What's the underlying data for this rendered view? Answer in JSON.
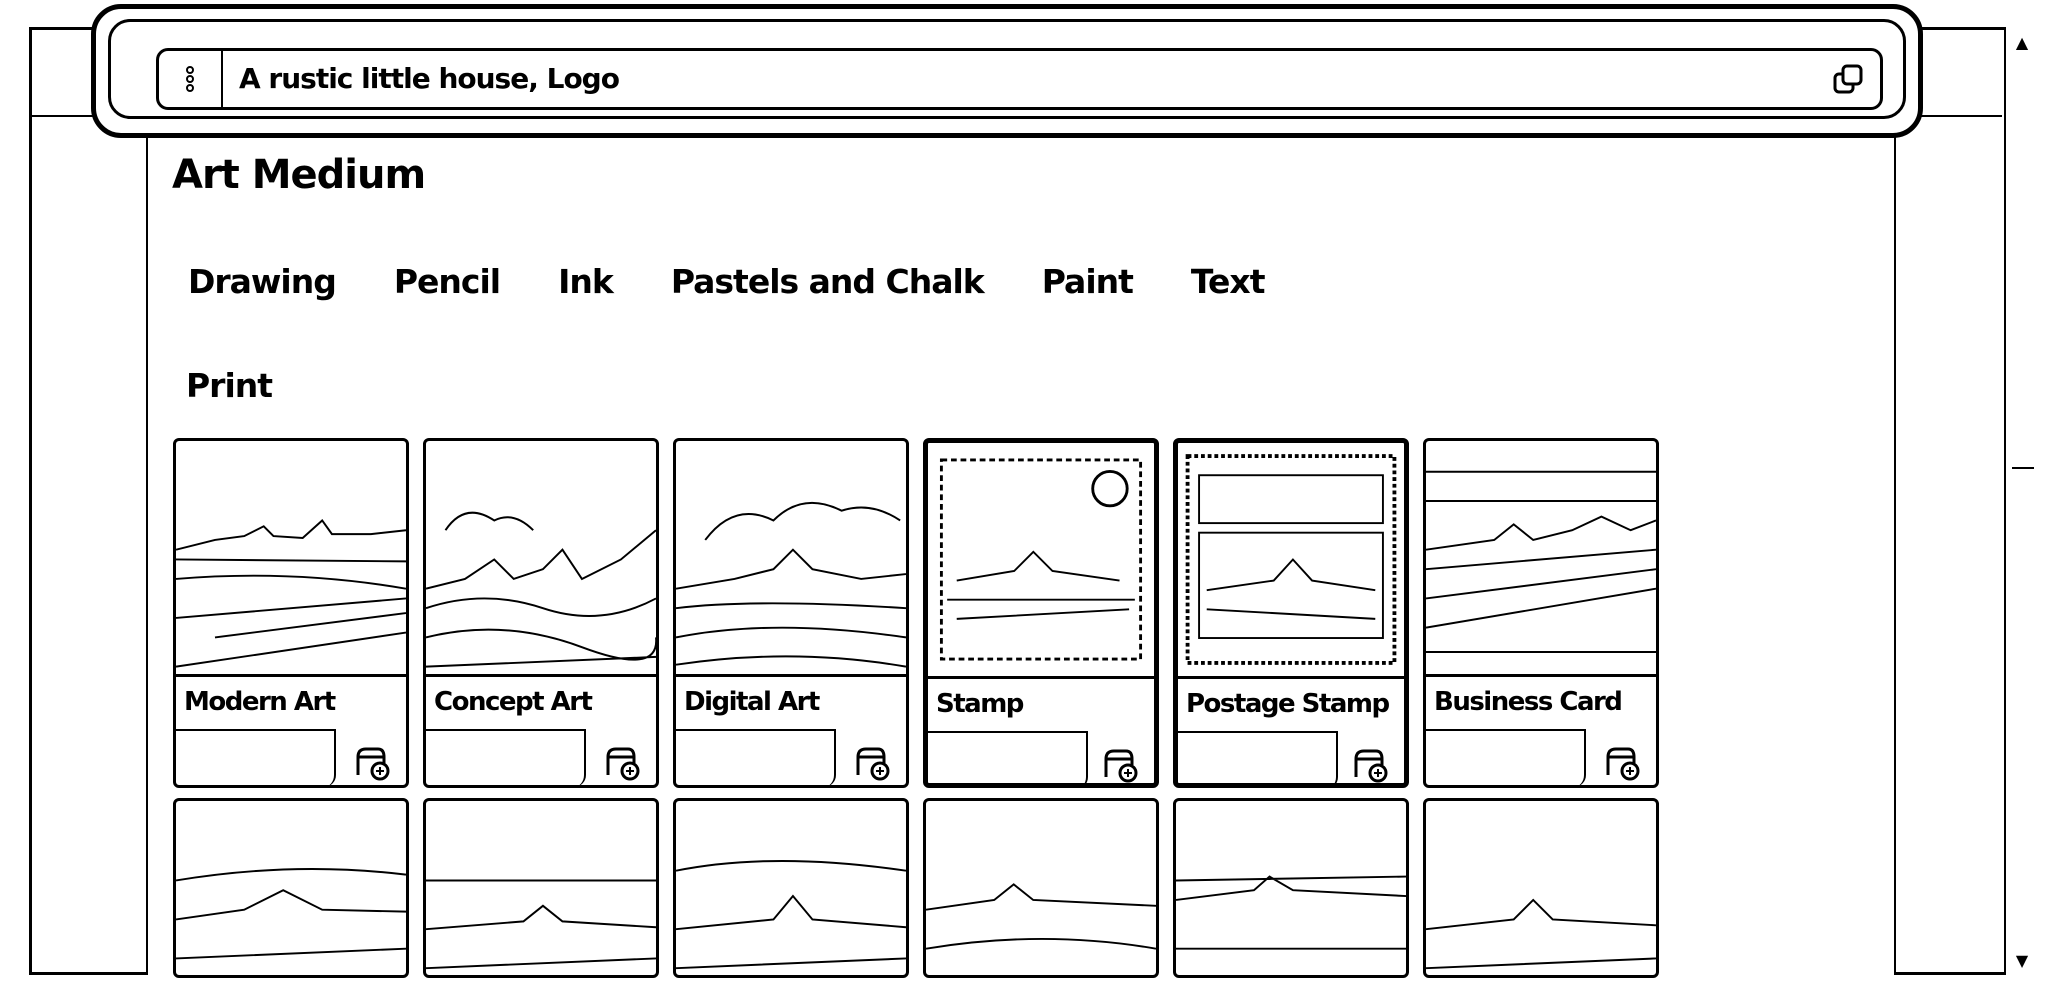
{
  "prompt": {
    "text": "A rustic little house, Logo"
  },
  "section": {
    "title": "Art Medium"
  },
  "tabs": [
    {
      "label": "Drawing"
    },
    {
      "label": "Pencil"
    },
    {
      "label": "Ink"
    },
    {
      "label": "Pastels and Chalk"
    },
    {
      "label": "Paint"
    },
    {
      "label": "Text"
    }
  ],
  "active_category": "Print",
  "cards_row1": [
    {
      "label": "Modern Art"
    },
    {
      "label": "Concept Art"
    },
    {
      "label": "Digital Art"
    },
    {
      "label": "Stamp"
    },
    {
      "label": "Postage Stamp"
    },
    {
      "label": "Business Card"
    }
  ],
  "icons": {
    "drag": "drag-handle-icon",
    "copy": "copy-icon",
    "add": "add-to-prompt-icon",
    "scroll_up": "scroll-up-icon",
    "scroll_down": "scroll-down-icon"
  }
}
